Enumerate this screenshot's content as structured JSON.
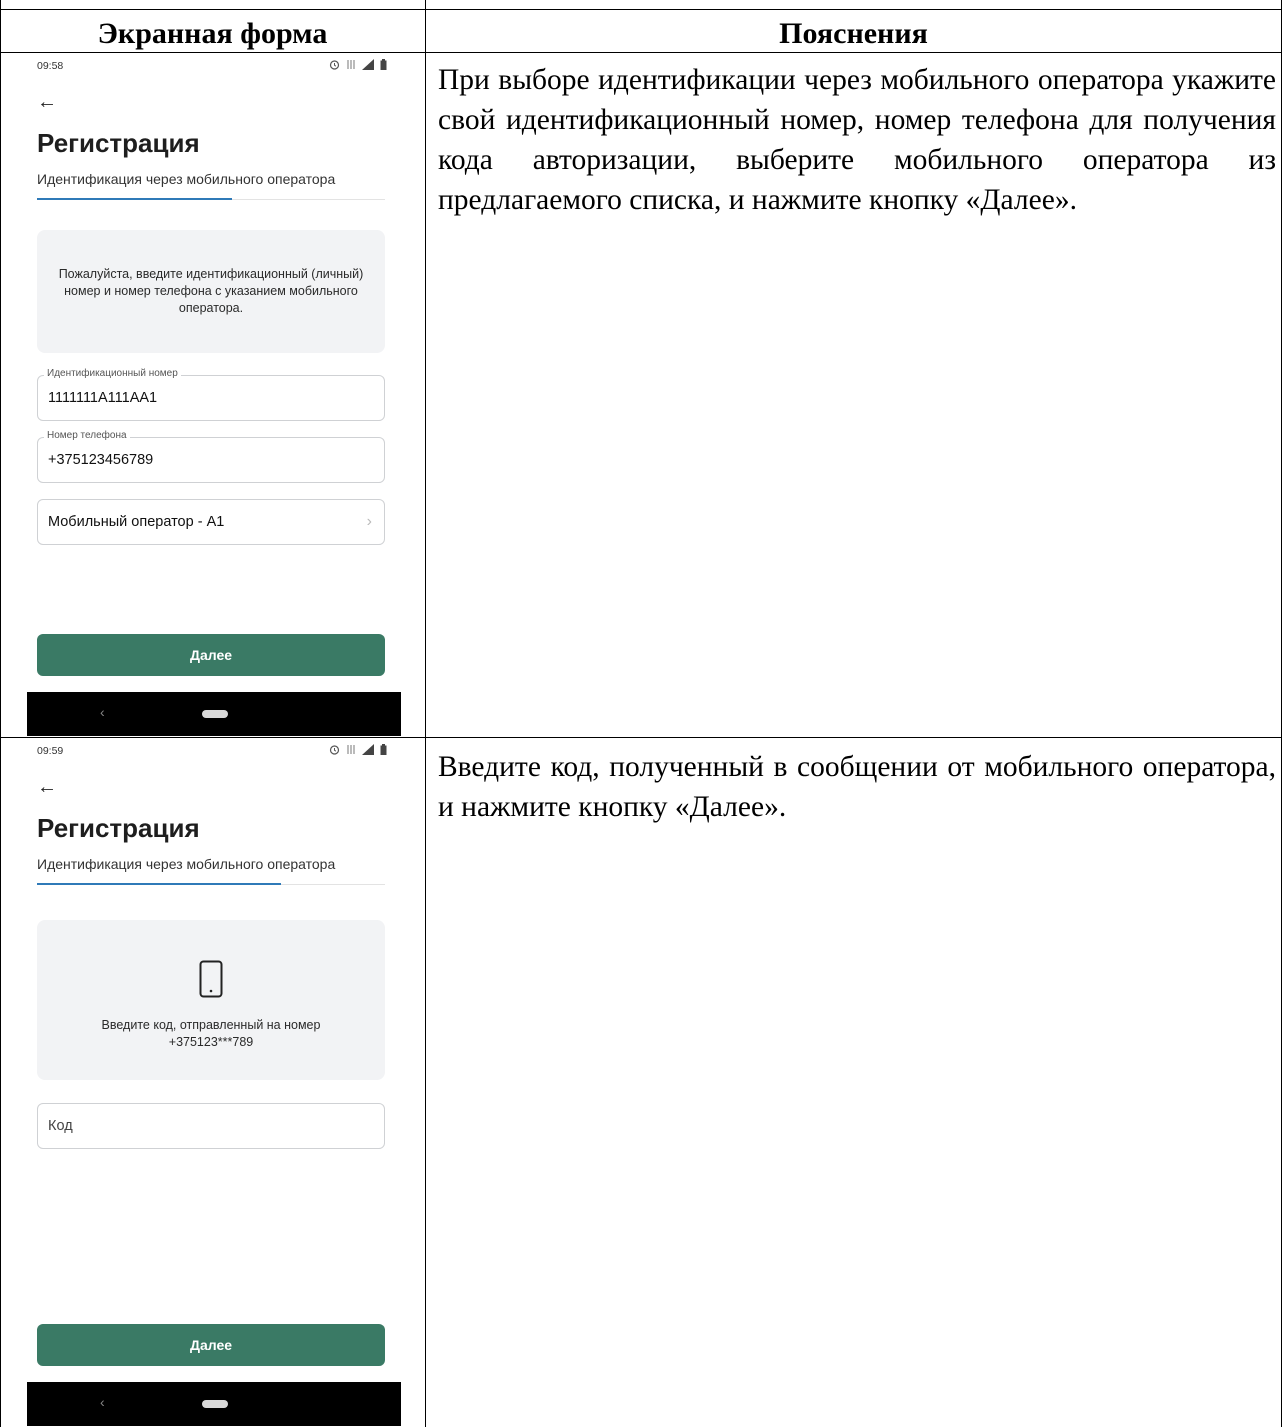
{
  "table": {
    "col_screen": "Экранная форма",
    "col_notes": "Пояснения"
  },
  "rows": [
    {
      "status_time": "09:58",
      "back_glyph": "←",
      "title": "Регистрация",
      "subtitle": "Идентификация через мобильного оператора",
      "progress_fraction": 0.56,
      "info_text": "Пожалуйста, введите идентификационный (личный) номер и номер телефона с указанием мобильного оператора.",
      "id_field": {
        "label": "Идентификационный номер",
        "value": "1111111A111AA1"
      },
      "phone_field": {
        "label": "Номер телефона",
        "value": "+375123456789"
      },
      "operator_select": {
        "value": "Мобильный оператор - А1",
        "chevron": "›"
      },
      "next_button": "Далее",
      "nav_back": "‹",
      "description": "При выборе идентификации через мобильного оператора укажите свой идентификационный номер, номер телефона для получения кода авторизации, выберите мобильного оператора из предлагаемого списка, и нажмите кнопку «Далее»."
    },
    {
      "status_time": "09:59",
      "back_glyph": "←",
      "title": "Регистрация",
      "subtitle": "Идентификация через мобильного оператора",
      "progress_fraction": 0.7,
      "info_icon": "smartphone-icon",
      "info_text": "Введите код, отправленный на номер +375123***789",
      "code_field": {
        "placeholder": "Код"
      },
      "next_button": "Далее",
      "nav_back": "‹",
      "description": "Введите код, полученный в сообщении от мобильного оператора, и нажмите кнопку «Далее»."
    }
  ],
  "icons": [
    "alarm-icon",
    "data-icon",
    "signal-icon",
    "battery-icon"
  ],
  "colors": {
    "accent_button": "#3a7a65",
    "progress": "#2f7ab8",
    "info_background": "#f2f3f5",
    "navbar": "#000000"
  }
}
